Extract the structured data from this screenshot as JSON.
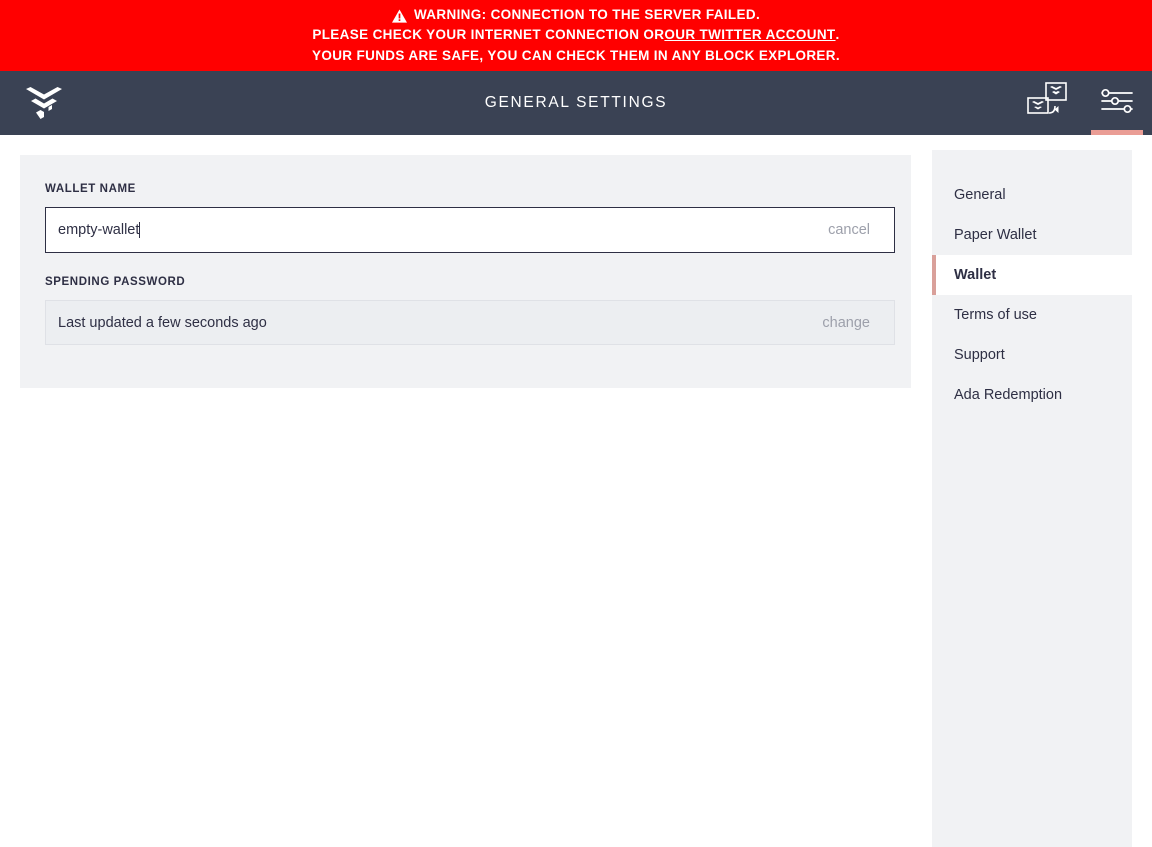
{
  "warning": {
    "icon": "warning-triangle-icon",
    "line1": "WARNING: CONNECTION TO THE SERVER FAILED.",
    "line2_prefix": "PLEASE CHECK YOUR INTERNET CONNECTION OR ",
    "line2_link": "OUR TWITTER ACCOUNT",
    "line2_suffix": ".",
    "line3": "YOUR FUNDS ARE SAFE, YOU CAN CHECK THEM IN ANY BLOCK EXPLORER.",
    "background_color": "#ff0000",
    "text_color": "#ffffff"
  },
  "topbar": {
    "logo": "daedalus-chevron-logo",
    "title": "General Settings",
    "background_color": "#3a4254",
    "actions": [
      {
        "name": "wallet-switch-icon",
        "active": false
      },
      {
        "name": "settings-sliders-icon",
        "active": true
      }
    ],
    "active_indicator_color": "#ea9d95"
  },
  "settings": {
    "wallet_name": {
      "label": "Wallet Name",
      "value": "empty-wallet",
      "placeholder": "Wallet Name",
      "action_label": "cancel",
      "focused": true
    },
    "spending_password": {
      "label": "Spending Password",
      "value": "Last updated a few seconds ago",
      "action_label": "change"
    }
  },
  "menu": {
    "active_index": 2,
    "active_accent_color": "#d9a09a",
    "items": [
      {
        "label": "General"
      },
      {
        "label": "Paper Wallet"
      },
      {
        "label": "Wallet"
      },
      {
        "label": "Terms of use"
      },
      {
        "label": "Support"
      },
      {
        "label": "Ada Redemption"
      }
    ]
  }
}
